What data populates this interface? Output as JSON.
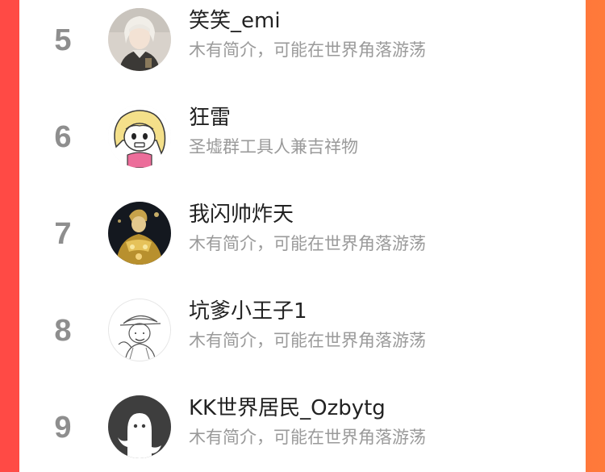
{
  "ranking": {
    "rows": [
      {
        "rank": "5",
        "name": "笑笑_emi",
        "bio": "木有简介，可能在世界角落游荡",
        "avatar_icon": "anime-boy-avatar-icon"
      },
      {
        "rank": "6",
        "name": "狂雷",
        "bio": "圣墟群工具人兼吉祥物",
        "avatar_icon": "cartoon-blonde-avatar-icon"
      },
      {
        "rank": "7",
        "name": "我闪帅炸天",
        "bio": "木有简介，可能在世界角落游荡",
        "avatar_icon": "golden-armor-avatar-icon"
      },
      {
        "rank": "8",
        "name": "坑爹小王子1",
        "bio": "木有简介，可能在世界角落游荡",
        "avatar_icon": "sketch-pirate-avatar-icon"
      },
      {
        "rank": "9",
        "name": "KK世界居民_Ozbytg",
        "bio": "木有简介，可能在世界角落游荡",
        "avatar_icon": "default-ghost-avatar-icon"
      }
    ]
  }
}
